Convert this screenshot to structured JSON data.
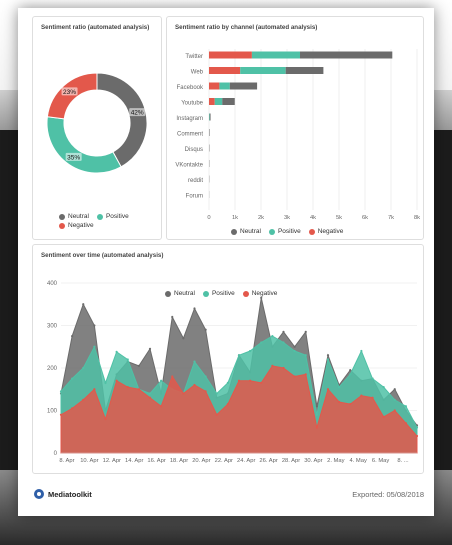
{
  "colors": {
    "neutral": "#6b6b6b",
    "positive": "#4fc1a6",
    "negative": "#e3584b"
  },
  "footer": {
    "brand": "Mediatoolkit",
    "exported": "Exported: 05/08/2018",
    "logo_icon": "mediatoolkit-logo-icon"
  },
  "chart_data": [
    {
      "id": "donut",
      "type": "pie",
      "title": "Sentiment ratio (automated analysis)",
      "labels": [
        "Neutral",
        "Positive",
        "Negative"
      ],
      "values": [
        42,
        35,
        23
      ],
      "value_labels": [
        "42%",
        "35%",
        "23%"
      ],
      "legend": "bottom"
    },
    {
      "id": "channels",
      "type": "bar",
      "orientation": "horizontal",
      "stacked": true,
      "title": "Sentiment ratio by channel (automated analysis)",
      "categories": [
        "Twitter",
        "Web",
        "Facebook",
        "Youtube",
        "Instagram",
        "Comment",
        "Disqus",
        "VKontakte",
        "reddit",
        "Forum"
      ],
      "series": [
        {
          "name": "Negative",
          "values": [
            1650,
            1200,
            400,
            220,
            0,
            0,
            0,
            0,
            0,
            0
          ]
        },
        {
          "name": "Positive",
          "values": [
            1850,
            1750,
            400,
            290,
            25,
            0,
            0,
            0,
            0,
            0
          ]
        },
        {
          "name": "Neutral",
          "values": [
            3550,
            1450,
            1050,
            480,
            35,
            20,
            15,
            12,
            10,
            5
          ]
        }
      ],
      "xticks": [
        "0",
        "1k",
        "2k",
        "3k",
        "4k",
        "5k",
        "6k",
        "7k",
        "8k"
      ],
      "xlim": [
        0,
        8000
      ],
      "legend_order": [
        "Neutral",
        "Positive",
        "Negative"
      ],
      "legend": "bottom"
    },
    {
      "id": "timeline",
      "type": "area",
      "title": "Sentiment over time (automated analysis)",
      "x_labels": [
        "8. Apr",
        "10. Apr",
        "12. Apr",
        "14. Apr",
        "16. Apr",
        "18. Apr",
        "20. Apr",
        "22. Apr",
        "24. Apr",
        "26. Apr",
        "28. Apr",
        "30. Apr",
        "2. May",
        "4. May",
        "6. May",
        "8. ..."
      ],
      "yticks": [
        "0",
        "100",
        "200",
        "300",
        "400"
      ],
      "ylim": [
        0,
        400
      ],
      "series": [
        {
          "name": "Neutral",
          "values": [
            140,
            275,
            350,
            300,
            100,
            185,
            215,
            205,
            245,
            140,
            320,
            270,
            340,
            290,
            130,
            140,
            230,
            190,
            365,
            250,
            285,
            250,
            285,
            110,
            230,
            160,
            195,
            170,
            175,
            125,
            150,
            100,
            65
          ]
        },
        {
          "name": "Positive",
          "values": [
            145,
            175,
            200,
            250,
            165,
            238,
            220,
            150,
            140,
            170,
            150,
            140,
            215,
            180,
            140,
            165,
            230,
            240,
            260,
            275,
            260,
            240,
            230,
            90,
            220,
            155,
            185,
            240,
            175,
            155,
            125,
            110,
            60
          ]
        },
        {
          "name": "Negative",
          "values": [
            90,
            105,
            125,
            150,
            80,
            170,
            155,
            150,
            130,
            110,
            180,
            140,
            160,
            145,
            90,
            115,
            170,
            170,
            165,
            205,
            200,
            180,
            185,
            60,
            150,
            120,
            115,
            135,
            130,
            85,
            100,
            70,
            40
          ]
        }
      ],
      "legend_order": [
        "Neutral",
        "Positive",
        "Negative"
      ],
      "legend": "top-center",
      "grid": true
    }
  ]
}
